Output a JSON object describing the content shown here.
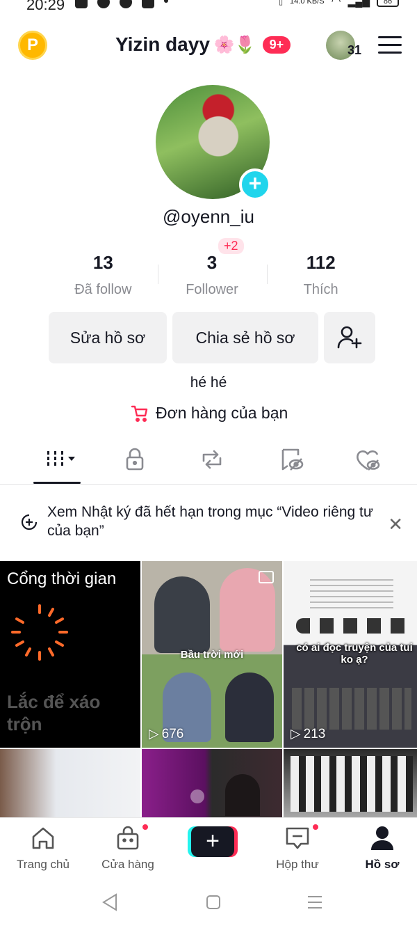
{
  "status_bar": {
    "time": "20:29",
    "net_speed": "14.0 KB/S",
    "battery": "86"
  },
  "header": {
    "title": "Yizin dayy",
    "title_emoji": "🌸🌷",
    "notif_badge": "9+",
    "coin_letter": "P",
    "avatar_count": "31"
  },
  "profile": {
    "username": "@oyenn_iu",
    "stats": [
      {
        "value": "13",
        "label": "Đã follow"
      },
      {
        "value": "3",
        "label": "Follower"
      },
      {
        "value": "112",
        "label": "Thích"
      }
    ],
    "follower_increment": "+2",
    "bio": "hé hé"
  },
  "buttons": {
    "edit": "Sửa hồ sơ",
    "share": "Chia sẻ hồ sơ"
  },
  "orders": {
    "label": "Đơn hàng của bạn"
  },
  "notice": {
    "text": "Xem Nhật ký đã hết hạn trong mục “Video riêng tư của bạn”"
  },
  "grid": {
    "portal": {
      "title": "Cổng thời gian",
      "subtitle": "Lắc để xáo trộn"
    },
    "video_2": {
      "caption": "Bầu trời mới",
      "views": "676"
    },
    "video_3": {
      "caption": "có ai đọc truyện của tui ko ạ?",
      "views": "213"
    }
  },
  "bottom_nav": {
    "home": "Trang chủ",
    "shop": "Cửa hàng",
    "inbox": "Hộp thư",
    "profile": "Hồ sơ"
  },
  "colors": {
    "accent": "#fe2c55",
    "cyan": "#25f4ee",
    "text": "#161823",
    "muted": "#8a8b91"
  }
}
